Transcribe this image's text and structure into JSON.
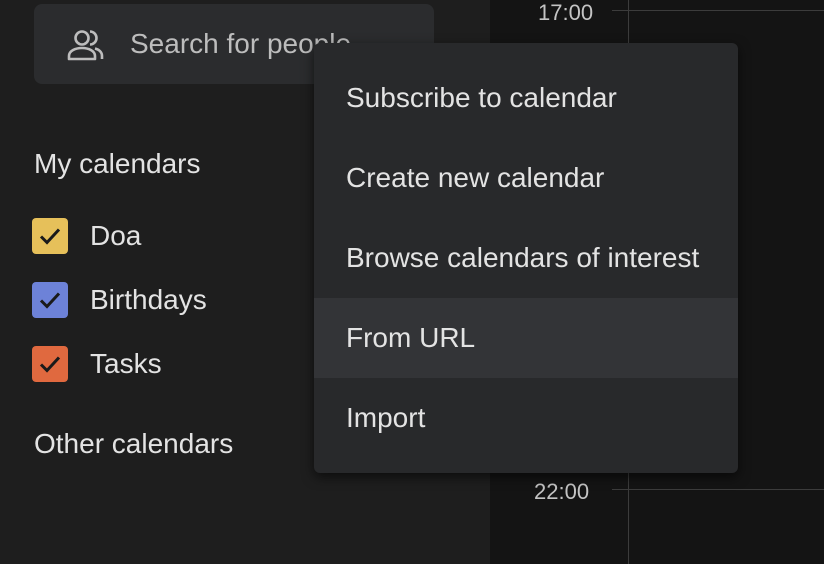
{
  "search": {
    "placeholder": "Search for people",
    "icon": "people-icon"
  },
  "my_calendars": {
    "title": "My calendars",
    "items": [
      {
        "label": "Doa",
        "color": "#e6c05a",
        "checked": true
      },
      {
        "label": "Birthdays",
        "color": "#6d82d8",
        "checked": true
      },
      {
        "label": "Tasks",
        "color": "#e0693f",
        "checked": true
      }
    ]
  },
  "other_calendars": {
    "title": "Other calendars"
  },
  "time_grid": {
    "labels": [
      "17:00",
      "22:00"
    ]
  },
  "add_menu": {
    "items": [
      {
        "label": "Subscribe to calendar"
      },
      {
        "label": "Create new calendar"
      },
      {
        "label": "Browse calendars of interest"
      },
      {
        "label": "From URL"
      },
      {
        "label": "Import"
      }
    ],
    "highlighted": "From URL"
  }
}
